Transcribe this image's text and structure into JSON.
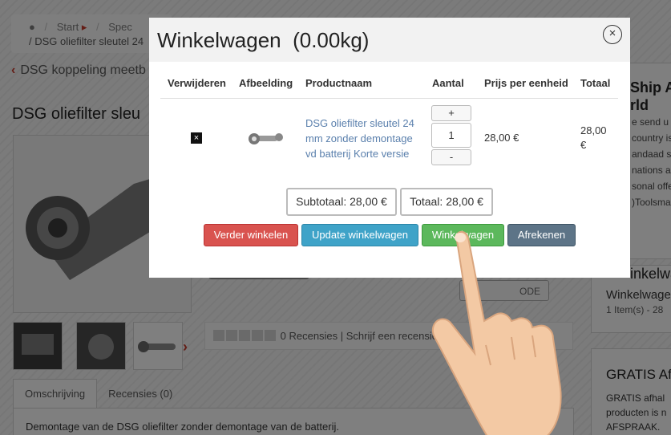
{
  "background": {
    "breadcrumb": {
      "item1": "Start",
      "item2": "Spec",
      "current": "DSG oliefilter sleutel 24"
    },
    "back_link": "DSG koppeling meetb",
    "product_title": "DSG oliefilter sleu",
    "reviews_text": "0 Recensies | Schrijf een recensie",
    "tabs": [
      "Omschrijving",
      "Recensies (0)"
    ],
    "description": "Demontage van de DSG oliefilter zonder demontage van de batterij.",
    "partial_button": "ODE",
    "side_box1": {
      "title_lines": [
        "Ship A",
        "rld"
      ],
      "lines": [
        "e send u",
        "country is",
        "andaad s",
        "nations a",
        "sonal offe",
        ")Toolsma"
      ]
    },
    "side_box2": {
      "title": "inkelwa",
      "cart": "Winkelwage",
      "items": "1 Item(s) - 28"
    },
    "side_box3": {
      "title": "GRATIS Af",
      "lines": [
        "GRATIS afhal",
        "producten is n",
        "AFSPRAAK."
      ]
    }
  },
  "modal": {
    "title": "Winkelwagen  (0.00kg)",
    "close_icon": "×",
    "columns": [
      "Verwijderen",
      "Afbeelding",
      "Productnaam",
      "Aantal",
      "Prijs per eenheid",
      "Totaal"
    ],
    "row": {
      "remove_icon": "×",
      "product_name": "DSG oliefilter sleutel 24 mm zonder demontage vd batterij Korte versie",
      "qty_plus": "+",
      "quantity": "1",
      "qty_minus": "-",
      "unit_price": "28,00 €",
      "total": "28,00 €"
    },
    "subtotal": "Subtotaal: 28,00 €",
    "grand_total": "Totaal: 28,00 €",
    "buttons": {
      "continue": "Verder winkelen",
      "update": "Update winkelwagen",
      "cart": "Winkelwagen",
      "checkout": "Afrekenen"
    }
  },
  "colors": {
    "continue": "#d9534f",
    "update": "#3fa3c8",
    "cart": "#5cb85c",
    "checkout": "#5d7487",
    "link": "#5b80ad"
  }
}
